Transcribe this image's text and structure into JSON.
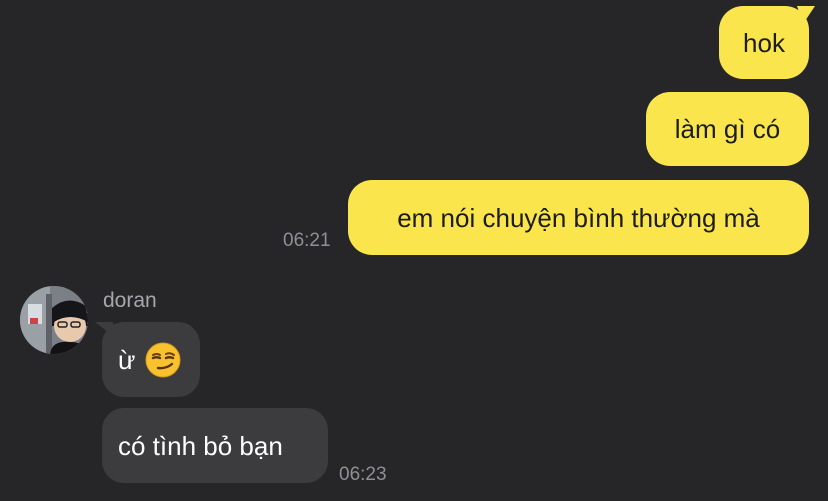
{
  "messages_out": [
    {
      "text": "hok"
    },
    {
      "text": "làm gì có"
    },
    {
      "text": "em nói chuyện bình thường mà",
      "time": "06:21"
    }
  ],
  "sender": {
    "name": "doran"
  },
  "messages_in": [
    {
      "text": "ừ",
      "emoji": "smirking-face"
    },
    {
      "text": "có tình bỏ bạn",
      "time": "06:23"
    }
  ],
  "colors": {
    "background": "#262629",
    "outgoing_bubble": "#fae64c",
    "incoming_bubble": "#3c3c3f",
    "timestamp": "#8f8f94"
  }
}
